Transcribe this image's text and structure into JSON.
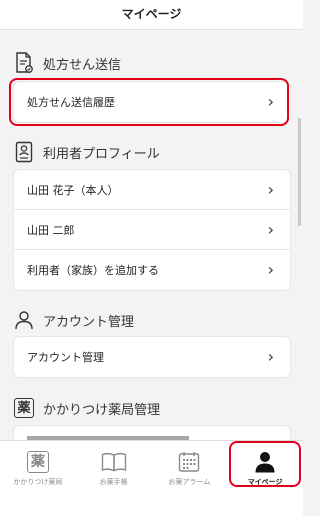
{
  "header": {
    "title": "マイページ"
  },
  "sections": {
    "prescription": {
      "title": "処方せん送信",
      "icon": "prescription-document-icon",
      "items": [
        {
          "label": "処方せん送信履歴"
        }
      ]
    },
    "profile": {
      "title": "利用者プロフィール",
      "icon": "profile-card-icon",
      "items": [
        {
          "label": "山田 花子（本人）"
        },
        {
          "label": "山田 二郎"
        },
        {
          "label": "利用者（家族）を追加する"
        }
      ]
    },
    "account": {
      "title": "アカウント管理",
      "icon": "person-outline-icon",
      "items": [
        {
          "label": "アカウント管理"
        }
      ]
    },
    "pharmacy": {
      "title": "かかりつけ薬局管理",
      "icon_text": "薬",
      "items": [
        {
          "label": ""
        }
      ]
    }
  },
  "chevron": "›",
  "tabs": [
    {
      "label": "かかりつけ薬局",
      "icon_text": "薬",
      "active": false
    },
    {
      "label": "お薬手帳",
      "icon": "book-icon",
      "active": false
    },
    {
      "label": "お薬アラーム",
      "icon": "calendar-icon",
      "active": false
    },
    {
      "label": "マイページ",
      "icon": "person-filled-icon",
      "active": true
    }
  ],
  "colors": {
    "highlight": "#e3001b",
    "background": "#f3f3f3"
  }
}
